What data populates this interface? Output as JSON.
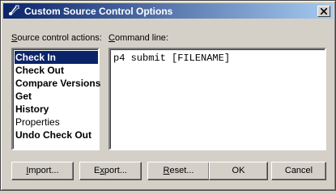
{
  "window": {
    "title": "Custom Source Control Options"
  },
  "labels": {
    "actions_underline": "S",
    "actions_rest": "ource control actions:",
    "command_underline": "C",
    "command_rest": "ommand line:"
  },
  "actions": [
    {
      "label": "Check In",
      "bold": true,
      "selected": true
    },
    {
      "label": "Check Out",
      "bold": true,
      "selected": false
    },
    {
      "label": "Compare Versions",
      "bold": true,
      "selected": false
    },
    {
      "label": "Get",
      "bold": true,
      "selected": false
    },
    {
      "label": "History",
      "bold": true,
      "selected": false
    },
    {
      "label": "Properties",
      "bold": false,
      "selected": false
    },
    {
      "label": "Undo Check Out",
      "bold": true,
      "selected": false
    }
  ],
  "command_line": {
    "value": "p4 submit [FILENAME]"
  },
  "buttons": {
    "import_underline": "I",
    "import_rest": "mport...",
    "export_prefix": "E",
    "export_underline": "x",
    "export_rest": "port...",
    "reset_underline": "R",
    "reset_rest": "eset...",
    "ok": "OK",
    "cancel": "Cancel"
  },
  "colors": {
    "selection": "#0a246a",
    "dialog": "#d4d0c8"
  }
}
